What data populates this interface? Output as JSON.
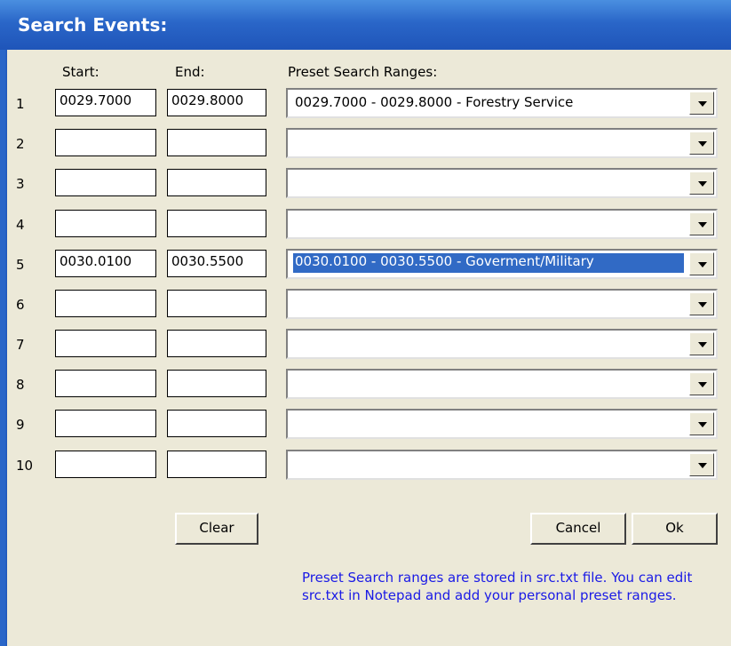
{
  "window": {
    "title": "Search Events:"
  },
  "headers": {
    "start": "Start:",
    "end": "End:",
    "preset": "Preset Search Ranges:"
  },
  "rows": [
    {
      "num": "1",
      "start": "0029.7000",
      "end": "0029.8000",
      "preset": "0029.7000 - 0029.8000 - Forestry Service",
      "selected": false
    },
    {
      "num": "2",
      "start": "",
      "end": "",
      "preset": "",
      "selected": false
    },
    {
      "num": "3",
      "start": "",
      "end": "",
      "preset": "",
      "selected": false
    },
    {
      "num": "4",
      "start": "",
      "end": "",
      "preset": "",
      "selected": false
    },
    {
      "num": "5",
      "start": "0030.0100",
      "end": "0030.5500",
      "preset": "0030.0100 - 0030.5500 - Goverment/Military",
      "selected": true
    },
    {
      "num": "6",
      "start": "",
      "end": "",
      "preset": "",
      "selected": false
    },
    {
      "num": "7",
      "start": "",
      "end": "",
      "preset": "",
      "selected": false
    },
    {
      "num": "8",
      "start": "",
      "end": "",
      "preset": "",
      "selected": false
    },
    {
      "num": "9",
      "start": "",
      "end": "",
      "preset": "",
      "selected": false
    },
    {
      "num": "10",
      "start": "",
      "end": "",
      "preset": "",
      "selected": false
    }
  ],
  "buttons": {
    "clear": "Clear",
    "cancel": "Cancel",
    "ok": "Ok"
  },
  "note": "Preset Search ranges are stored in src.txt file.   You can edit src.txt in Notepad and add your personal preset ranges.",
  "colors": {
    "titlebar": "#2a66c8",
    "dialog_bg": "#ece9d8",
    "selection": "#316ac5",
    "note_text": "#1a1ae6"
  }
}
